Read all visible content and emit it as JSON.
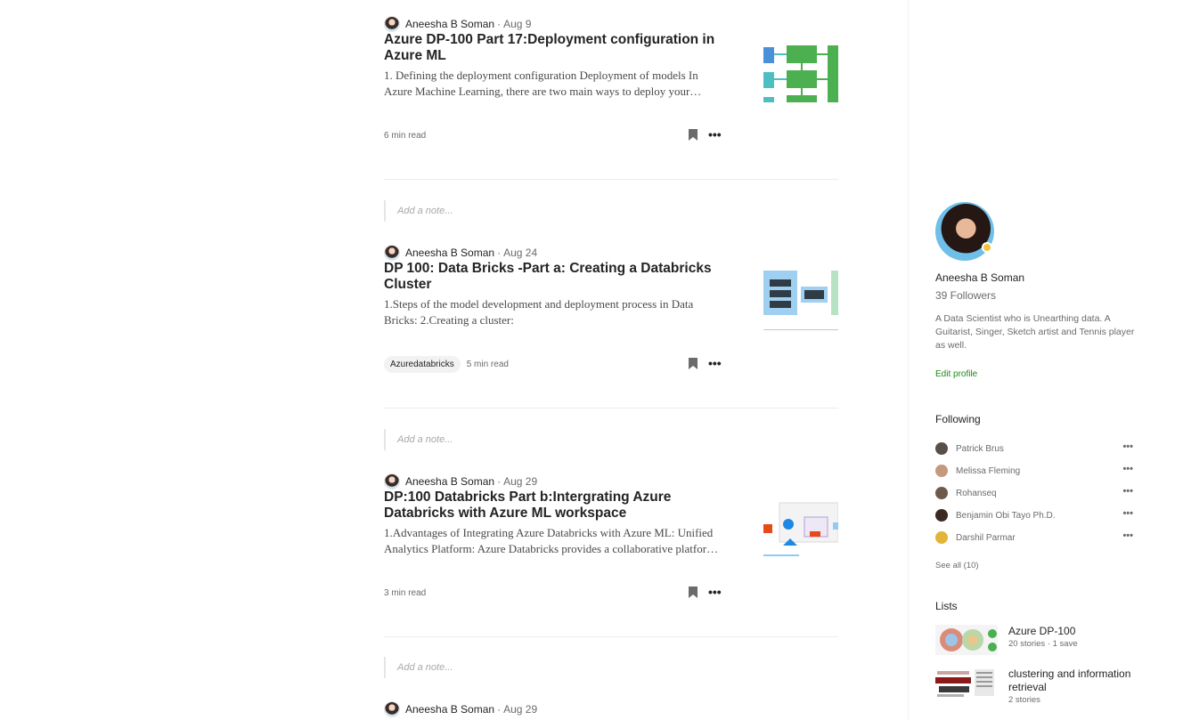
{
  "posts": [
    {
      "author": "Aneesha B Soman",
      "date": "Aug 9",
      "title": "Azure DP-100 Part 17:Deployment configuration in Azure ML",
      "excerpt": "1. Defining the deployment configuration Deployment of models In Azure Machine Learning, there are two main ways to deploy your…",
      "tag": "",
      "read_time": "6 min read",
      "note_placeholder": "Add a note..."
    },
    {
      "author": "Aneesha B Soman",
      "date": "Aug 24",
      "title": "DP 100: Data Bricks -Part a: Creating a Databricks Cluster",
      "excerpt": "1.Steps of the model development and deployment process in Data Bricks: 2.Creating a cluster:",
      "tag": "Azuredatabricks",
      "read_time": "5 min read",
      "note_placeholder": "Add a note..."
    },
    {
      "author": "Aneesha B Soman",
      "date": "Aug 29",
      "title": "DP:100 Databricks Part b:Intergrating Azure Databricks with Azure ML workspace",
      "excerpt": "1.Advantages of Integrating Azure Databricks with Azure ML: Unified Analytics Platform: Azure Databricks provides a collaborative platfor…",
      "tag": "",
      "read_time": "3 min read",
      "note_placeholder": "Add a note..."
    },
    {
      "author": "Aneesha B Soman",
      "date": "Aug 29"
    }
  ],
  "profile": {
    "name": "Aneesha B Soman",
    "followers": "39 Followers",
    "bio": "A Data Scientist who is Unearthing data. A Guitarist, Singer, Sketch artist and Tennis player as well.",
    "edit_label": "Edit profile"
  },
  "following": {
    "heading": "Following",
    "people": [
      {
        "name": "Patrick Brus",
        "avatar_color": "#5a4e4a"
      },
      {
        "name": "Melissa Fleming",
        "avatar_color": "#c49a7e"
      },
      {
        "name": "Rohanseq",
        "avatar_color": "#6d5a4a"
      },
      {
        "name": "Benjamin Obi Tayo Ph.D.",
        "avatar_color": "#3a2a22"
      },
      {
        "name": "Darshil Parmar",
        "avatar_color": "#e3b43a"
      }
    ],
    "see_all": "See all (10)"
  },
  "lists": {
    "heading": "Lists",
    "items": [
      {
        "title": "Azure DP-100",
        "meta": "20 stories  ·  1 save"
      },
      {
        "title": "clustering and information retrieval",
        "meta": "2 stories"
      }
    ]
  }
}
